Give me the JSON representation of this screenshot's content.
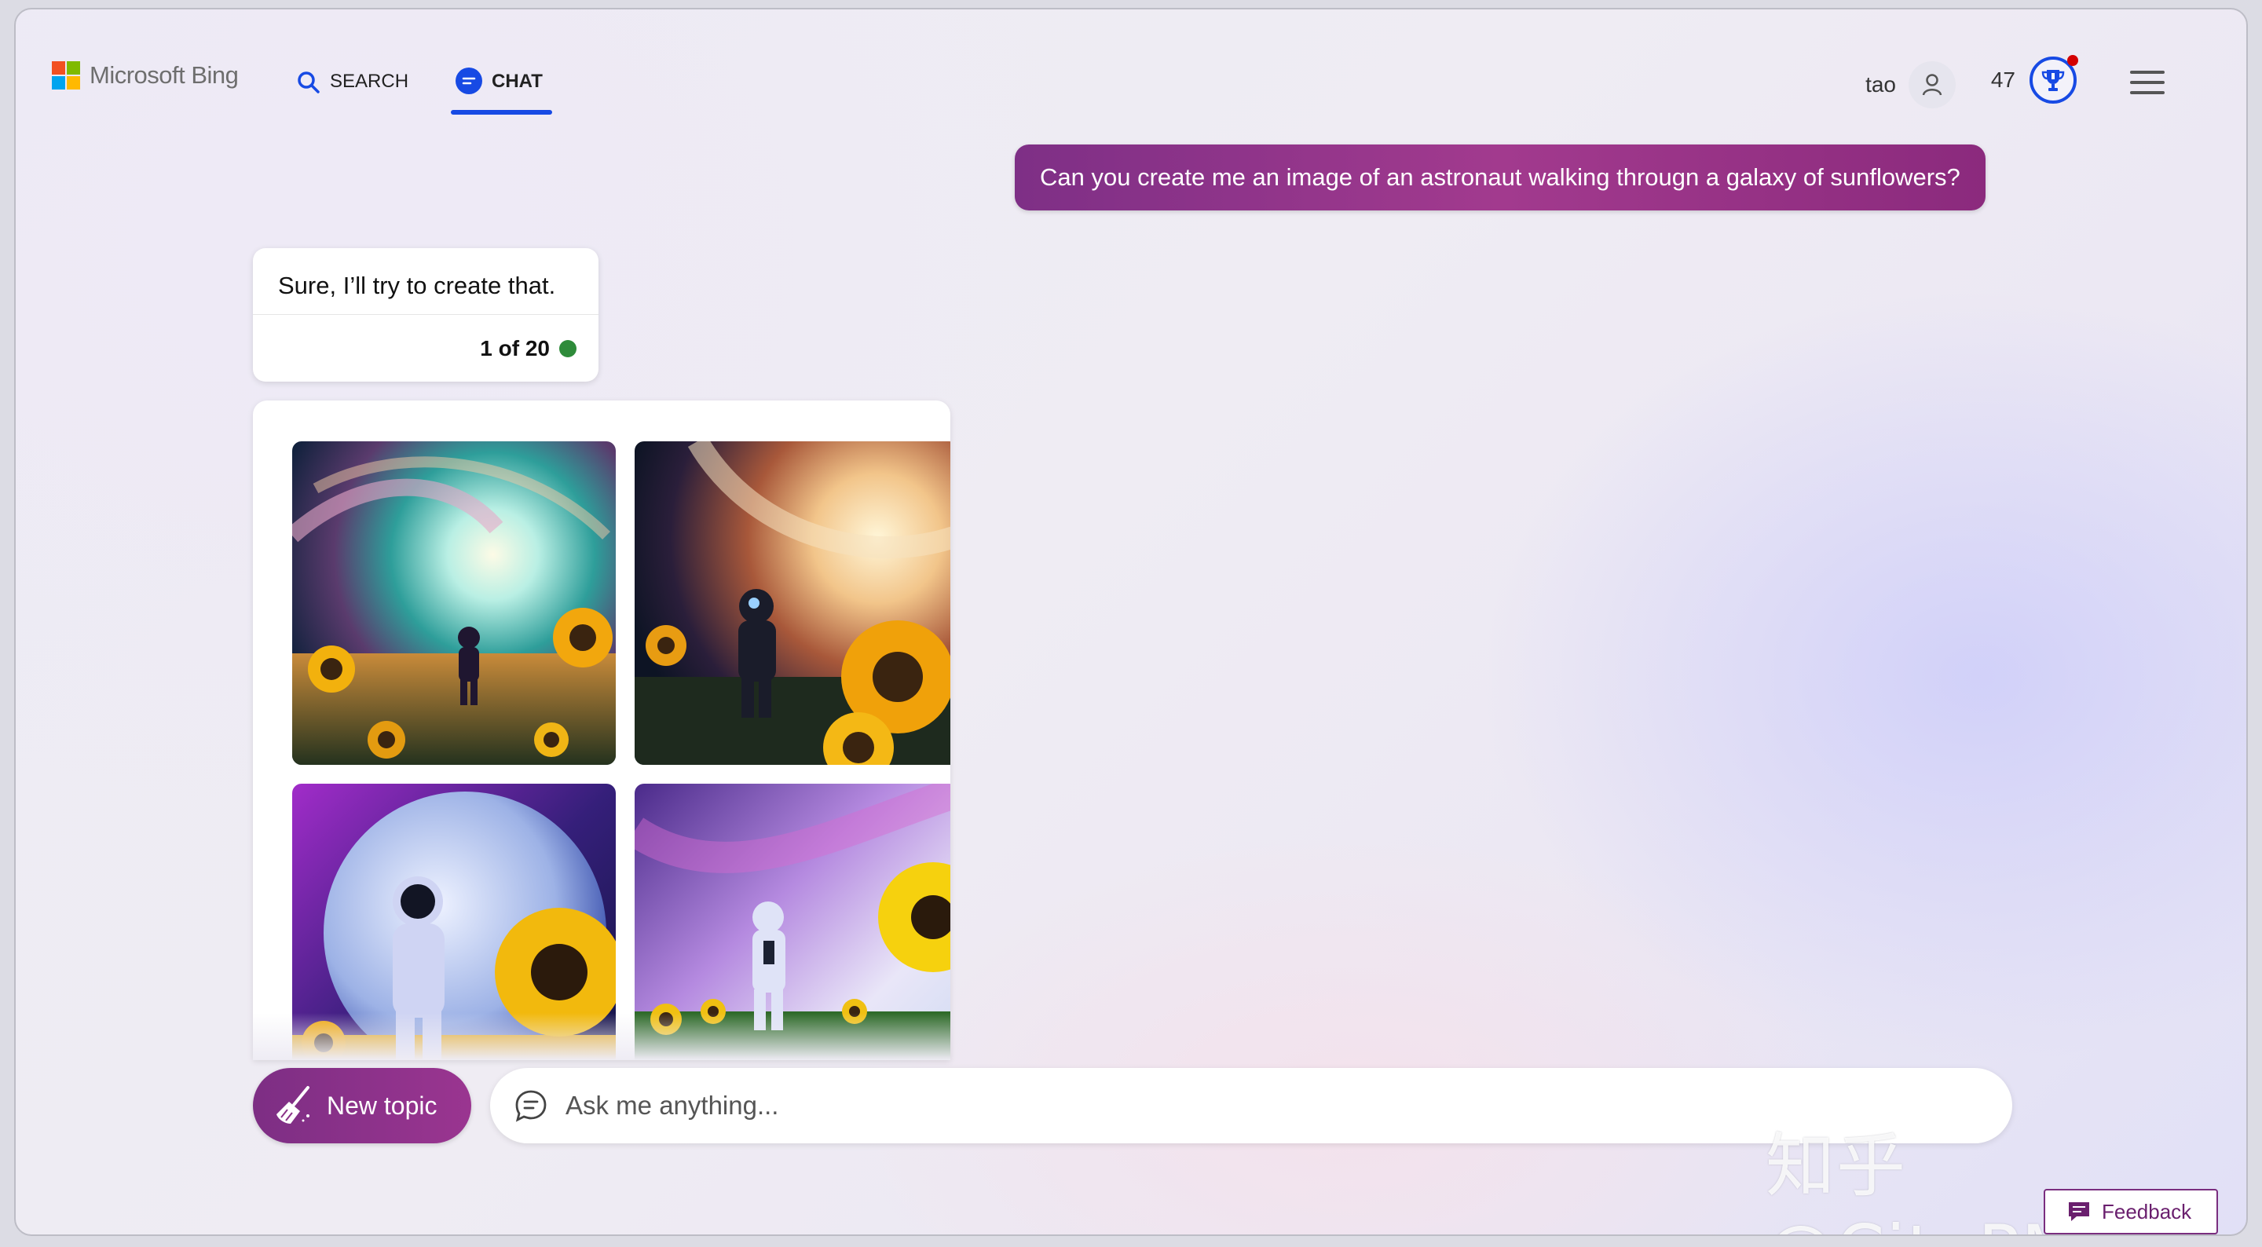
{
  "header": {
    "brand": "Microsoft Bing",
    "tabs": [
      {
        "label": "SEARCH",
        "icon": "search-icon",
        "active": false
      },
      {
        "label": "CHAT",
        "icon": "chat-icon",
        "active": true
      }
    ],
    "user_name": "tao",
    "reward_points": "47",
    "accent_color": "#174ae4"
  },
  "conversation": {
    "user_message": "Can you create me an image of an astronaut walking througn a galaxy of sunflowers?",
    "bot_reply": "Sure, I’ll try to create that.",
    "turn_counter": "1 of 20",
    "status_color": "#2e8b3a",
    "images": [
      {
        "subject": "astronaut walking in sunflower field under teal galaxy swirl"
      },
      {
        "subject": "astronaut facing glowing galaxy with large sunflower"
      },
      {
        "subject": "astronaut in front of large blue moon with sunflowers"
      },
      {
        "subject": "astronaut walking in sunflower field under milky way"
      }
    ]
  },
  "composer": {
    "new_topic_label": "New topic",
    "input_placeholder": "Ask me anything...",
    "brand_gradient": [
      "#7d2e84",
      "#9a3590"
    ]
  },
  "watermark": "知乎 @CityPM",
  "feedback_label": "Feedback"
}
